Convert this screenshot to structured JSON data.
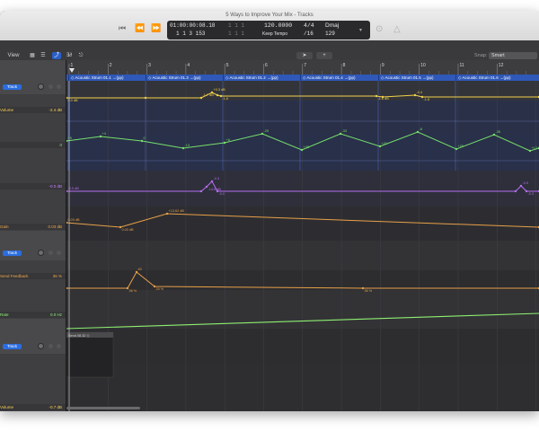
{
  "window": {
    "title": "5 Ways to Improve Your Mix - Tracks"
  },
  "lcd": {
    "time": "01:00:00:08.18",
    "bars": "1  1  3  153",
    "pos2": "1  1  1",
    "pos3": "1  1  1",
    "tempo": "120.0000",
    "tempo_mode": "Keep Tempo",
    "signature": "4/4",
    "division": "/16",
    "key": "Dmaj",
    "key_extra": "129"
  },
  "toolbar": {
    "view_label": "View",
    "snap_label": "Snap:",
    "snap_value": "Smart"
  },
  "ruler": {
    "bars": [
      "1",
      "2",
      "3",
      "4",
      "5",
      "6",
      "7",
      "8",
      "9",
      "10",
      "11",
      "12"
    ]
  },
  "regions": [
    "Acoustic Strum 01.1",
    "Acoustic Strum 01.3",
    "Acoustic Strum 01.2",
    "Acoustic Strum 01.4",
    "Acoustic Strum 01.5",
    "Acoustic Strum 01.6"
  ],
  "region_prefix": "◇",
  "region_suffix": "→(pp)",
  "headers": [
    {
      "kind": "track",
      "button": "Track"
    },
    {
      "kind": "auto",
      "label": "Volume",
      "value": "-2.4 dB",
      "color": "#ffd24d"
    },
    {
      "kind": "auto",
      "label": "",
      "value": "0",
      "color": "#7fe07a"
    },
    {
      "kind": "auto",
      "label": "",
      "value": "-0.0 dB",
      "color": "#c77dff"
    },
    {
      "kind": "auto",
      "label": "Gain",
      "value": "0.03 dB",
      "color": "#f0a848"
    },
    {
      "kind": "track",
      "button": "Track"
    },
    {
      "kind": "auto",
      "label": "Send Feedback",
      "value": "36 %",
      "color": "#f0a848"
    },
    {
      "kind": "auto",
      "label": "Rate",
      "value": "0.0 Hz",
      "color": "#8ef070"
    },
    {
      "kind": "track",
      "button": "Track"
    },
    {
      "kind": "auto",
      "label": "Volume",
      "value": "-0.7 dB",
      "color": "#ffd24d"
    }
  ],
  "automation": {
    "yellow_points": [
      "0.0 dB",
      "-1.7 dB",
      "+0.3 dB",
      "-1.6",
      "-1.6 dB",
      "-0.4",
      "-1.8"
    ],
    "green_points": [
      "+5",
      "+4",
      "0",
      "-13",
      "+8",
      "-25",
      "+28",
      "-33",
      "+21",
      "-8",
      "+25",
      "-35",
      "+12",
      "-4"
    ],
    "purple_points": [
      "-0.0 dB",
      "-14.6 dB",
      "-0.3",
      "-0.0",
      "-0.5",
      "-0.3"
    ],
    "orange_points": [
      "0.03 dB",
      "+13.62 dB",
      "0.03 dB"
    ],
    "send_points": [
      "36 %",
      "40",
      "25 %",
      "36 %"
    ],
    "clip_label": "Send 08.32 ◇"
  },
  "icons": {
    "rewind": "⏮",
    "back": "⏪",
    "forward": "⏩",
    "play": "▶",
    "record": "●",
    "tuner": "⊙",
    "metronome": "△"
  }
}
